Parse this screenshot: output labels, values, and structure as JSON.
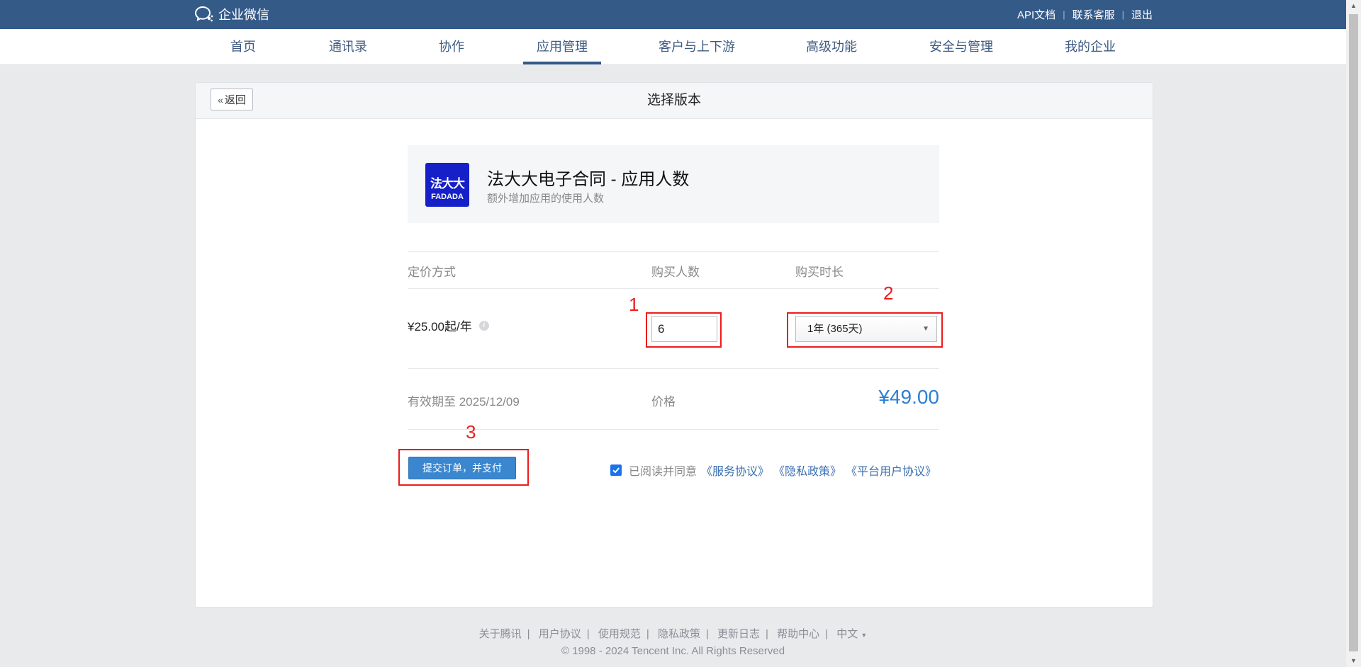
{
  "topbar": {
    "brand": "企业微信",
    "links": [
      "API文档",
      "联系客服",
      "退出"
    ],
    "sep": "|"
  },
  "nav": {
    "items": [
      "首页",
      "通讯录",
      "协作",
      "应用管理",
      "客户与上下游",
      "高级功能",
      "安全与管理",
      "我的企业"
    ],
    "active_index": 3
  },
  "page": {
    "back_label": "返回",
    "back_icon": "double-chevron-left-icon",
    "title": "选择版本"
  },
  "app": {
    "logo_cn": "法大大",
    "logo_en": "FADADA",
    "logo_color": "#1620c8",
    "name": "法大大电子合同 - 应用人数",
    "desc": "额外增加应用的使用人数"
  },
  "table": {
    "headers": [
      "定价方式",
      "购买人数",
      "购买时长"
    ],
    "pricing": "¥25.00起/年",
    "quantity": "6",
    "duration": "1年 (365天)",
    "valid_until": "有效期至 2025/12/09",
    "price_label": "价格",
    "total_price": "¥49.00",
    "price_color": "#2c7ed6"
  },
  "actions": {
    "submit_label": "提交订单，并支付",
    "agree_text": "已阅读并同意",
    "agreements": [
      "《服务协议》",
      "《隐私政策》",
      "《平台用户协议》"
    ],
    "checked": true
  },
  "annotations": {
    "labels": [
      "1",
      "2",
      "3"
    ],
    "color": "#ee1b1b"
  },
  "footer": {
    "links": [
      "关于腾讯",
      "用户协议",
      "使用规范",
      "隐私政策",
      "更新日志",
      "帮助中心",
      "中文"
    ],
    "sep": "|",
    "lang_arrow": "▼",
    "copyright": "© 1998 - 2024 Tencent Inc. All Rights Reserved"
  }
}
